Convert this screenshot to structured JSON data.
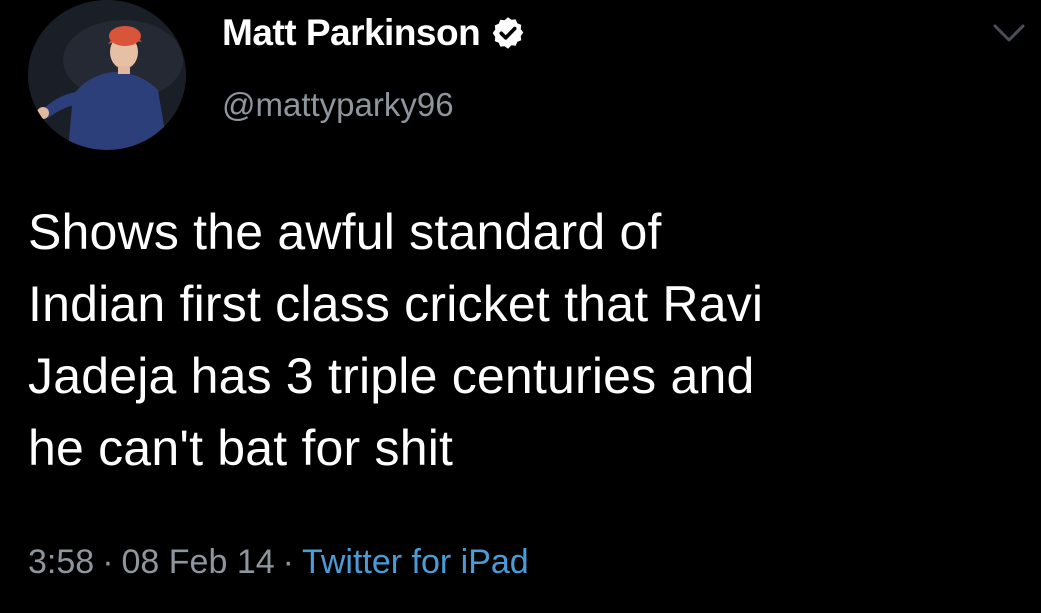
{
  "tweet": {
    "author": {
      "display_name": "Matt Parkinson",
      "handle": "@mattyparky96",
      "verified": true,
      "verified_icon": "verified-badge-icon"
    },
    "text": "Shows the awful standard of\nIndian first class cricket that Ravi\nJadeja has 3 triple centuries and\nhe can't bat for shit",
    "time": "3:58",
    "date": "08 Feb 14",
    "separator": "·",
    "source": "Twitter for iPad",
    "menu_icon": "chevron-down-icon",
    "colors": {
      "background": "#000000",
      "text": "#ffffff",
      "muted": "#8e959c",
      "link": "#4a9bd6"
    }
  }
}
